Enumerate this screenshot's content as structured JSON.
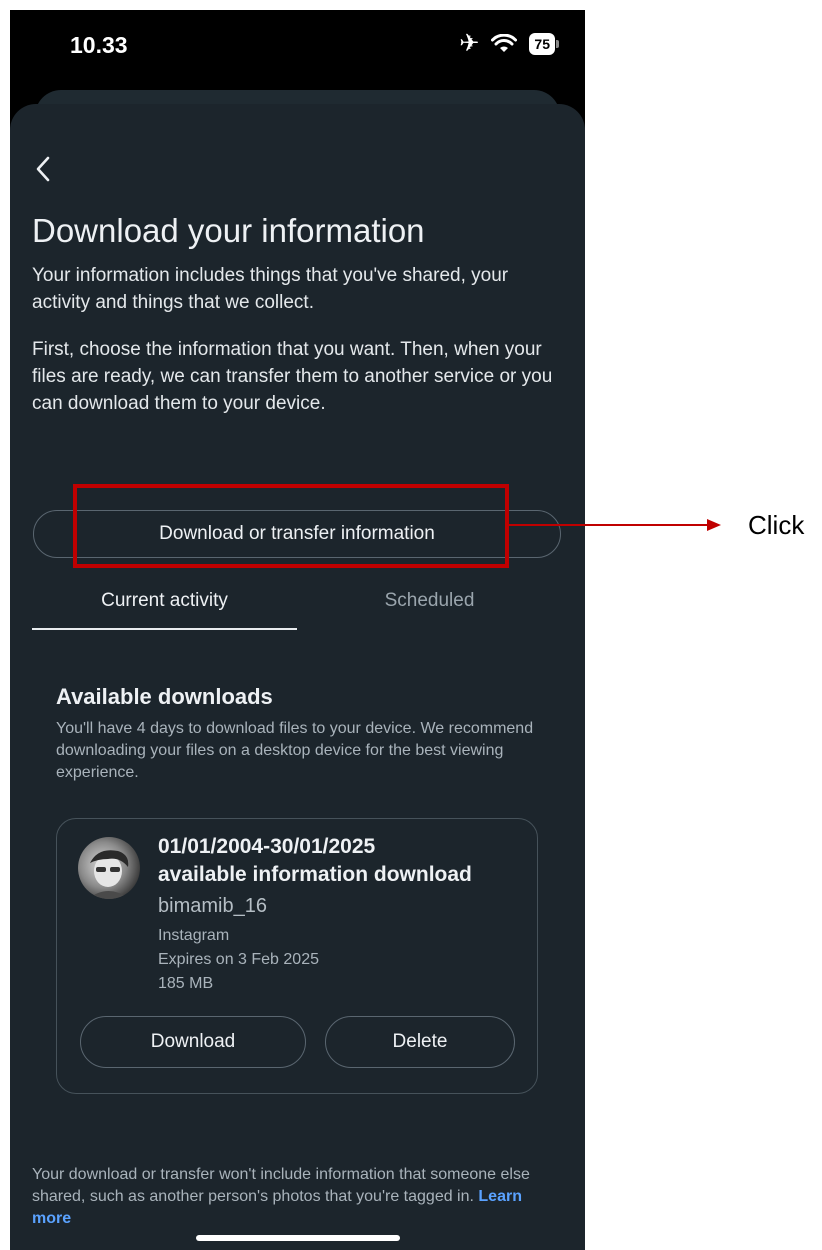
{
  "status_bar": {
    "time": "10.33",
    "battery": "75"
  },
  "header": {
    "title": "Download your information",
    "intro_1": "Your information includes things that you've shared, your activity and things that we collect.",
    "intro_2": "First, choose the information that you want. Then, when your files are ready, we can transfer them to another service or you can download them to your device."
  },
  "primary_button": "Download or transfer information",
  "tabs": [
    {
      "label": "Current activity",
      "active": true
    },
    {
      "label": "Scheduled",
      "active": false
    }
  ],
  "available": {
    "title": "Available downloads",
    "description": "You'll have 4 days to download files to your device. We recommend downloading your files on a desktop device for the best viewing experience."
  },
  "download_card": {
    "date_range": "01/01/2004-30/01/2025",
    "label": "available information download",
    "username": "bimamib_16",
    "app": "Instagram",
    "expires": "Expires on 3 Feb 2025",
    "size": "185 MB",
    "download_button": "Download",
    "delete_button": "Delete"
  },
  "footer": {
    "text": "Your download or transfer won't include information that someone else shared, such as another person's photos that you're tagged in.",
    "link": "Learn more"
  },
  "annotation": {
    "label": "Click",
    "color": "#c00000"
  }
}
